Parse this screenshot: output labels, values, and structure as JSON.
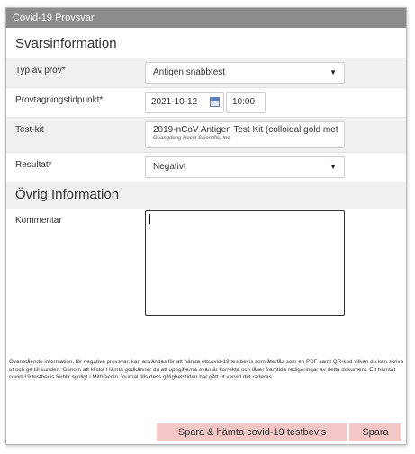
{
  "dialog": {
    "title": "Covid-19 Provsvar"
  },
  "svarsinfo": {
    "heading": "Svarsinformation",
    "test_type": {
      "label": "Typ av prov*",
      "value": "Antigen snabbtest"
    },
    "sampling_time": {
      "label": "Provtagningstidpunkt*",
      "date": "2021-10-12",
      "time": "10:00"
    },
    "test_kit": {
      "label": "Test-kit",
      "name": "2019-nCoV Antigen Test Kit (colloidal gold met",
      "maker": "Guangdong Hecin Scientific, Inc."
    },
    "result": {
      "label": "Resultat*",
      "value": "Negativt"
    }
  },
  "ovrig": {
    "heading": "Övrig Information",
    "comment": {
      "label": "Kommentar",
      "value": ""
    }
  },
  "notice": "Ovanstående information, för negativa provsvar, kan användas för att hämta ettcovid-19 testbevis som återfås som en PDF samt QR-kod vilken du kan skriva ut och ge till kunden. Genom att klicka Hämta godkänner du att uppgifterna ovan är korrekta och låser framtida redigeringar av detta dokument. Ett hämtat covid-19 testbevis förblir synligt i MittVaccin Journal tills dess giltighetstiden har gått ut varvid det raderas.",
  "actions": {
    "save_fetch": "Spara & hämta covid-19 testbevis",
    "save": "Spara"
  },
  "icons": {
    "dropdown": "chevron-down-icon",
    "calendar": "calendar-icon"
  },
  "colors": {
    "titlebar": "#8c8c8c",
    "button_bg": "#f4c7c7",
    "section_bg": "#f0f0f0"
  }
}
